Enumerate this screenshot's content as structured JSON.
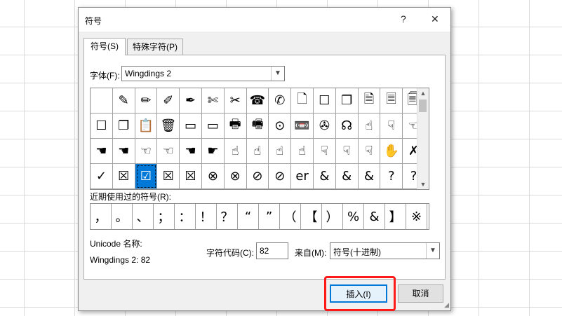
{
  "dialog": {
    "title": "符号",
    "help_label": "?",
    "close_label": "✕"
  },
  "tabs": [
    {
      "label": "符号(S)",
      "active": true
    },
    {
      "label": "特殊字符(P)",
      "active": false
    }
  ],
  "font": {
    "label": "字体(F):",
    "value": "Wingdings 2"
  },
  "symbols": [
    "",
    "✎",
    "✏",
    "✐",
    "✒",
    "✄",
    "✂",
    "☎",
    "✆",
    "🗋",
    "☐",
    "❐",
    "🗎",
    "🗏",
    "🗐",
    "☐",
    "❐",
    "📋",
    "🗑",
    "▭",
    "▭",
    "🖶",
    "🖷",
    "⊙",
    "📼",
    "✇",
    "☊",
    "☝",
    "☟",
    "☜",
    "☚",
    "☚",
    "☜",
    "☜",
    "☚",
    "☛",
    "☝",
    "☝",
    "☝",
    "☝",
    "☟",
    "☟",
    "☟",
    "✋",
    "✗",
    "✓",
    "☒",
    "☑",
    "☒",
    "☒",
    "⊗",
    "⊗",
    "⊘",
    "⊘",
    "er",
    "&",
    "&",
    "&",
    "?",
    "?"
  ],
  "selected_index": 47,
  "recent": {
    "label": "近期使用过的符号(R):",
    "items": [
      "，",
      "。",
      "、",
      "；",
      "：",
      "！",
      "？",
      "“",
      "”",
      "（",
      "【",
      "）",
      "%",
      "&",
      "】",
      "※"
    ]
  },
  "unicode": {
    "name_label": "Unicode 名称:",
    "name_value": "Wingdings 2: 82"
  },
  "charcode": {
    "label": "字符代码(C):",
    "value": "82"
  },
  "from": {
    "label": "来自(M):",
    "value": "符号(十进制)"
  },
  "buttons": {
    "insert": "插入(I)",
    "cancel": "取消"
  },
  "colors": {
    "accent": "#0078d7",
    "highlight_box": "#ff1a1a"
  }
}
